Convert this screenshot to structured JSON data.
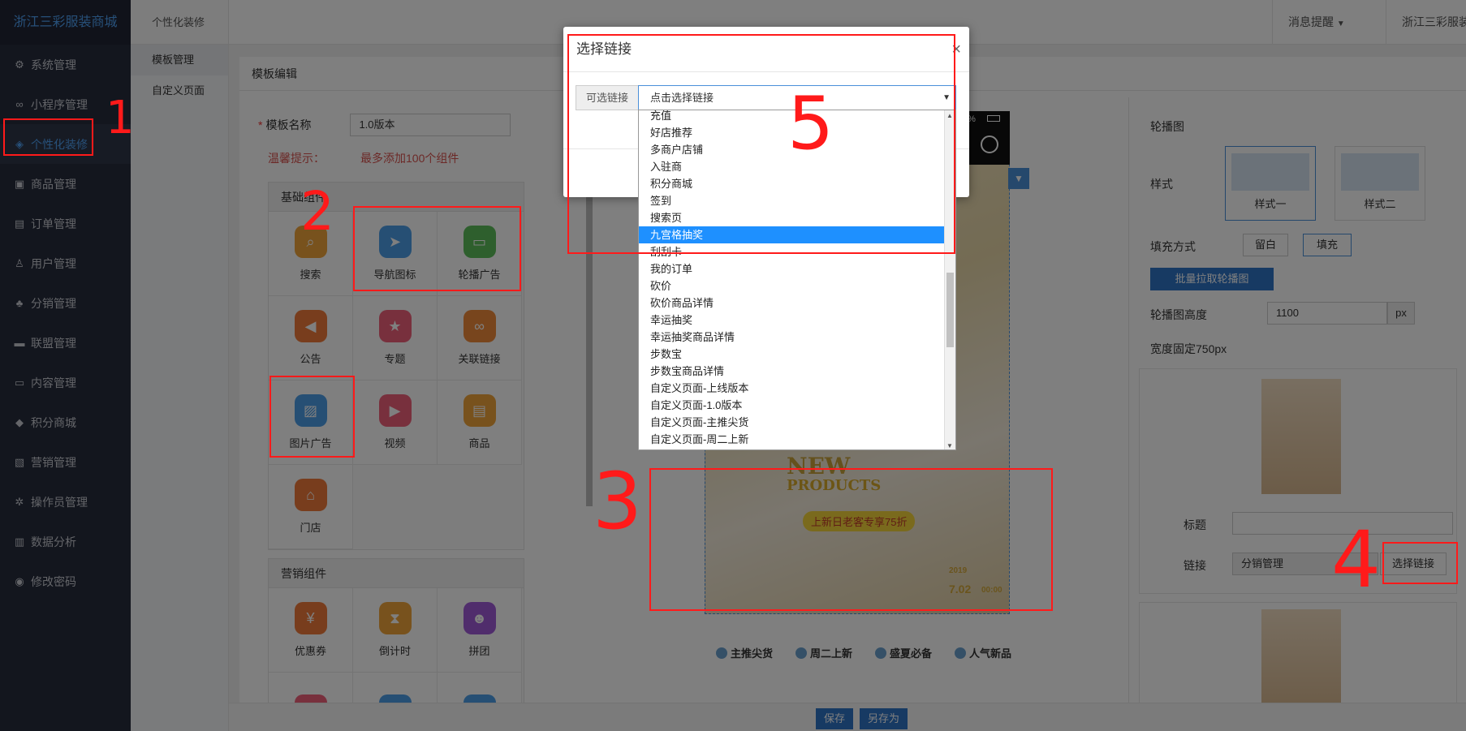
{
  "sidebar": {
    "brand": "浙江三彩服装商城",
    "items": [
      {
        "label": "系统管理",
        "icon": "gear-icon",
        "glyph": "⚙"
      },
      {
        "label": "小程序管理",
        "icon": "link-icon",
        "glyph": "∞"
      },
      {
        "label": "个性化装修",
        "icon": "palette-icon",
        "glyph": "◈",
        "active": true
      },
      {
        "label": "商品管理",
        "icon": "bag-icon",
        "glyph": "▣"
      },
      {
        "label": "订单管理",
        "icon": "calendar-icon",
        "glyph": "▤"
      },
      {
        "label": "用户管理",
        "icon": "user-icon",
        "glyph": "♙"
      },
      {
        "label": "分销管理",
        "icon": "sitemap-icon",
        "glyph": "♣"
      },
      {
        "label": "联盟管理",
        "icon": "store-icon",
        "glyph": "▬"
      },
      {
        "label": "内容管理",
        "icon": "content-icon",
        "glyph": "▭"
      },
      {
        "label": "积分商城",
        "icon": "cube-icon",
        "glyph": "◆"
      },
      {
        "label": "营销管理",
        "icon": "coupon-icon",
        "glyph": "▧"
      },
      {
        "label": "操作员管理",
        "icon": "cog-icon",
        "glyph": "✲"
      },
      {
        "label": "数据分析",
        "icon": "chart-icon",
        "glyph": "▥"
      },
      {
        "label": "修改密码",
        "icon": "shield-icon",
        "glyph": "◉"
      }
    ]
  },
  "subnav": {
    "head": "个性化装修",
    "items": [
      "模板管理",
      "自定义页面"
    ]
  },
  "topbar": {
    "messages": "消息提醒",
    "user": "浙江三彩服装"
  },
  "editor": {
    "title": "模板编辑",
    "name_label": "模板名称",
    "name_value": "1.0版本",
    "tip_label": "温馨提示：",
    "tip_value": "最多添加100个组件",
    "basic_group": "基础组件",
    "basic": [
      {
        "label": "搜索",
        "color": "#f0a43a",
        "glyph": "⌕"
      },
      {
        "label": "导航图标",
        "color": "#4d9ee8",
        "glyph": "➤"
      },
      {
        "label": "轮播广告",
        "color": "#5cbf5a",
        "glyph": "▭"
      },
      {
        "label": "公告",
        "color": "#f07a3a",
        "glyph": "◀"
      },
      {
        "label": "专题",
        "color": "#f0607a",
        "glyph": "★"
      },
      {
        "label": "关联链接",
        "color": "#f08a3a",
        "glyph": "∞"
      },
      {
        "label": "图片广告",
        "color": "#4d9ee8",
        "glyph": "▨"
      },
      {
        "label": "视频",
        "color": "#f0607a",
        "glyph": "▶"
      },
      {
        "label": "商品",
        "color": "#f0a43a",
        "glyph": "▤"
      },
      {
        "label": "门店",
        "color": "#f07a3a",
        "glyph": "⌂"
      }
    ],
    "marketing_group": "营销组件",
    "marketing": [
      {
        "label": "优惠券",
        "color": "#f07a3a",
        "glyph": "¥"
      },
      {
        "label": "倒计时",
        "color": "#f0a43a",
        "glyph": "⧗"
      },
      {
        "label": "拼团",
        "color": "#a05ad8",
        "glyph": "☻"
      },
      {
        "label": "",
        "color": "#f0607a",
        "glyph": "◷"
      },
      {
        "label": "",
        "color": "#4d9ee8",
        "glyph": "▦"
      },
      {
        "label": "",
        "color": "#4d9ee8",
        "glyph": "≡"
      }
    ]
  },
  "preview": {
    "banner_text1": "NEW",
    "banner_text2": "PRODUCTS",
    "banner_badge": "上新日老客专享75折",
    "banner_year": "2019",
    "banner_date": "7.02",
    "banner_time": "00:00",
    "battery": "0%",
    "categories": [
      "主推尖货",
      "周二上新",
      "盛夏必备",
      "人气新品"
    ]
  },
  "settings": {
    "section": "轮播图",
    "style_label": "样式",
    "style1": "样式一",
    "style2": "样式二",
    "fill_label": "填充方式",
    "fill_opt1": "留白",
    "fill_opt2": "填充",
    "bulk_button": "批量拉取轮播图",
    "height_label": "轮播图高度",
    "height_value": "1100",
    "height_unit": "px",
    "width_note": "宽度固定750px",
    "card_title_label": "标题",
    "card_link_label": "链接",
    "card_link_value": "分销管理",
    "select_link_button": "选择链接"
  },
  "bottom": {
    "save": "保存",
    "save_as": "另存为"
  },
  "modal": {
    "title": "选择链接",
    "close": "×",
    "addon": "可选链接",
    "select_value": "点击选择链接",
    "options": [
      "充值",
      "好店推荐",
      "多商户店铺",
      "入驻商",
      "积分商城",
      "签到",
      "搜索页",
      "九宫格抽奖",
      "刮刮卡",
      "我的订单",
      "砍价",
      "砍价商品详情",
      "幸运抽奖",
      "幸运抽奖商品详情",
      "步数宝",
      "步数宝商品详情",
      "自定义页面-上线版本",
      "自定义页面-1.0版本",
      "自定义页面-主推尖货",
      "自定义页面-周二上新"
    ],
    "highlighted": "九宫格抽奖"
  },
  "annotations": [
    "1",
    "2",
    "3",
    "4",
    "5"
  ]
}
